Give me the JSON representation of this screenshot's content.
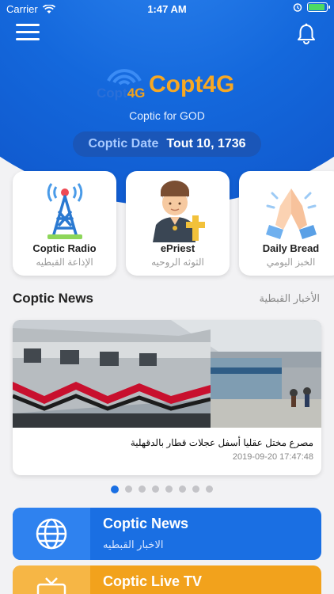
{
  "status_bar": {
    "carrier": "Carrier",
    "time": "1:47 AM",
    "battery_level": 0.9
  },
  "header": {
    "logo_small": "Copt",
    "logo_small_suffix": "4G",
    "logo_big": "Copt4G",
    "tagline": "Coptic for GOD",
    "date_label": "Coptic Date",
    "date_value": "Tout 10, 1736"
  },
  "cards": [
    {
      "en": "Coptic Radio",
      "ar": "الإذاعة القبطيه",
      "icon": "radio-tower-icon"
    },
    {
      "en": "ePriest",
      "ar": "الثوثه الروحيه",
      "icon": "priest-icon"
    },
    {
      "en": "Daily Bread",
      "ar": "الخبز اليومي",
      "icon": "praying-hands-icon"
    }
  ],
  "news": {
    "title": "Coptic News",
    "title_ar": "الأخبار القبطية",
    "headline": "مصرع مختل عقليا أسفل عجلات قطار بالدقهلية",
    "date": "2019-09-20 17:47:48",
    "dot_count": 8,
    "active_dot": 0
  },
  "menu_items": [
    {
      "en": "Coptic News",
      "ar": "الاخبار القبطيه",
      "icon": "globe-icon"
    },
    {
      "en": "Coptic Live TV",
      "ar": "",
      "icon": "tv-icon"
    }
  ],
  "colors": {
    "primary_blue": "#1a6fe3",
    "orange": "#f2a21c",
    "logo_orange": "#f7a823"
  }
}
